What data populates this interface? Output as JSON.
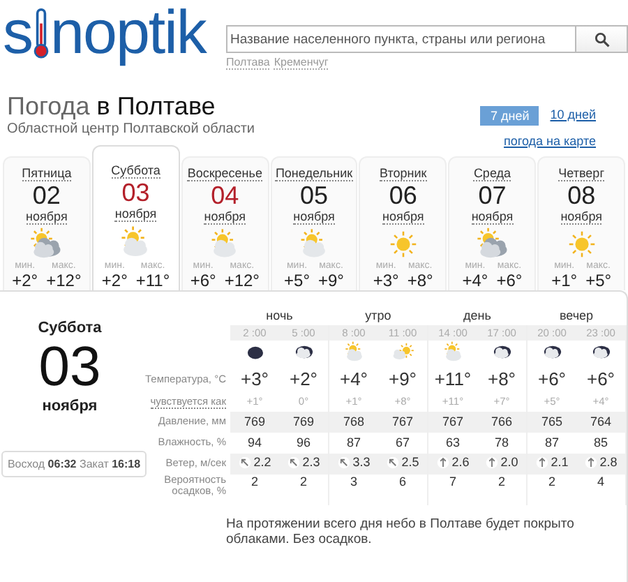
{
  "logo": {
    "before": "s",
    "after": "noptik"
  },
  "search": {
    "placeholder": "Название населенного пункта, страны или региона"
  },
  "recent": [
    "Полтава",
    "Кременчуг"
  ],
  "title": {
    "prefix": "Погода",
    "city": "в Полтаве",
    "subtitle": "Областной центр Полтавской области"
  },
  "range_tabs": [
    {
      "label": "7 дней",
      "selected": true
    },
    {
      "label": "10 дней",
      "selected": false
    }
  ],
  "map_link": "погода на карте",
  "days": [
    {
      "day": "Пятница",
      "date": "02",
      "month": "ноября",
      "kind": "cloudy",
      "min_label": "мин.",
      "min": "+2°",
      "max_label": "макс.",
      "max": "+12°",
      "weekend": false,
      "selected": false
    },
    {
      "day": "Суббота",
      "date": "03",
      "month": "ноября",
      "kind": "partly",
      "min_label": "мин.",
      "min": "+2°",
      "max_label": "макс.",
      "max": "+11°",
      "weekend": true,
      "selected": true
    },
    {
      "day": "Воскресенье",
      "date": "04",
      "month": "ноября",
      "kind": "partly",
      "min_label": "мин.",
      "min": "+6°",
      "max_label": "макс.",
      "max": "+12°",
      "weekend": true,
      "selected": false
    },
    {
      "day": "Понедельник",
      "date": "05",
      "month": "ноября",
      "kind": "partly",
      "min_label": "мин.",
      "min": "+5°",
      "max_label": "макс.",
      "max": "+9°",
      "weekend": false,
      "selected": false
    },
    {
      "day": "Вторник",
      "date": "06",
      "month": "ноября",
      "kind": "sun",
      "min_label": "мин.",
      "min": "+3°",
      "max_label": "макс.",
      "max": "+8°",
      "weekend": false,
      "selected": false
    },
    {
      "day": "Среда",
      "date": "07",
      "month": "ноября",
      "kind": "cloudy",
      "min_label": "мин.",
      "min": "+4°",
      "max_label": "макс.",
      "max": "+6°",
      "weekend": false,
      "selected": false
    },
    {
      "day": "Четверг",
      "date": "08",
      "month": "ноября",
      "kind": "sun",
      "min_label": "мин.",
      "min": "+1°",
      "max_label": "макс.",
      "max": "+5°",
      "weekend": false,
      "selected": false
    }
  ],
  "detail": {
    "day": "Суббота",
    "date": "03",
    "month": "ноября",
    "sun": "Восход **06:32** Закат **16:18**",
    "row_labels": [
      "Температура, °C",
      "чувствуется как",
      "Давление, мм",
      "Влажность, %",
      "Ветер, м/сек",
      "Вероятность осадков, %"
    ],
    "periods": [
      {
        "name": "ночь",
        "hours": [
          {
            "time": "2 :00",
            "kind": "moon",
            "temp": "+3°",
            "feels": "+1°",
            "pressure": "769",
            "humidity": "94",
            "wind": {
              "kind": "nw",
              "value": "2.2"
            },
            "precip": "2"
          },
          {
            "time": "5 :00",
            "kind": "night-cloud",
            "temp": "+2°",
            "feels": "0°",
            "pressure": "769",
            "humidity": "96",
            "wind": {
              "kind": "nw",
              "value": "2.3"
            },
            "precip": "2"
          }
        ]
      },
      {
        "name": "утро",
        "hours": [
          {
            "time": "8 :00",
            "kind": "partly",
            "temp": "+4°",
            "feels": "+1°",
            "pressure": "768",
            "humidity": "87",
            "wind": {
              "kind": "nw",
              "value": "3.3"
            },
            "precip": "3"
          },
          {
            "time": "11 :00",
            "kind": "sun-cloud",
            "temp": "+9°",
            "feels": "+8°",
            "pressure": "767",
            "humidity": "67",
            "wind": {
              "kind": "nw",
              "value": "2.5"
            },
            "precip": "6"
          }
        ]
      },
      {
        "name": "день",
        "hours": [
          {
            "time": "14 :00",
            "kind": "partly",
            "temp": "+11°",
            "feels": "+11°",
            "pressure": "767",
            "humidity": "63",
            "wind": {
              "kind": "n",
              "value": "2.6"
            },
            "precip": "7"
          },
          {
            "time": "17 :00",
            "kind": "night-cloud",
            "temp": "+8°",
            "feels": "+7°",
            "pressure": "766",
            "humidity": "78",
            "wind": {
              "kind": "n",
              "value": "2.0"
            },
            "precip": "2"
          }
        ]
      },
      {
        "name": "вечер",
        "hours": [
          {
            "time": "20 :00",
            "kind": "night-cloud",
            "temp": "+6°",
            "feels": "+5°",
            "pressure": "765",
            "humidity": "87",
            "wind": {
              "kind": "n",
              "value": "2.1"
            },
            "precip": "2"
          },
          {
            "time": "23 :00",
            "kind": "night-cloud",
            "temp": "+6°",
            "feels": "+4°",
            "pressure": "764",
            "humidity": "85",
            "wind": {
              "kind": "n",
              "value": "2.8"
            },
            "precip": "4"
          }
        ]
      }
    ],
    "description": "На протяжении всего дня небо в Полтаве будет покрыто облаками. Без осадков."
  }
}
